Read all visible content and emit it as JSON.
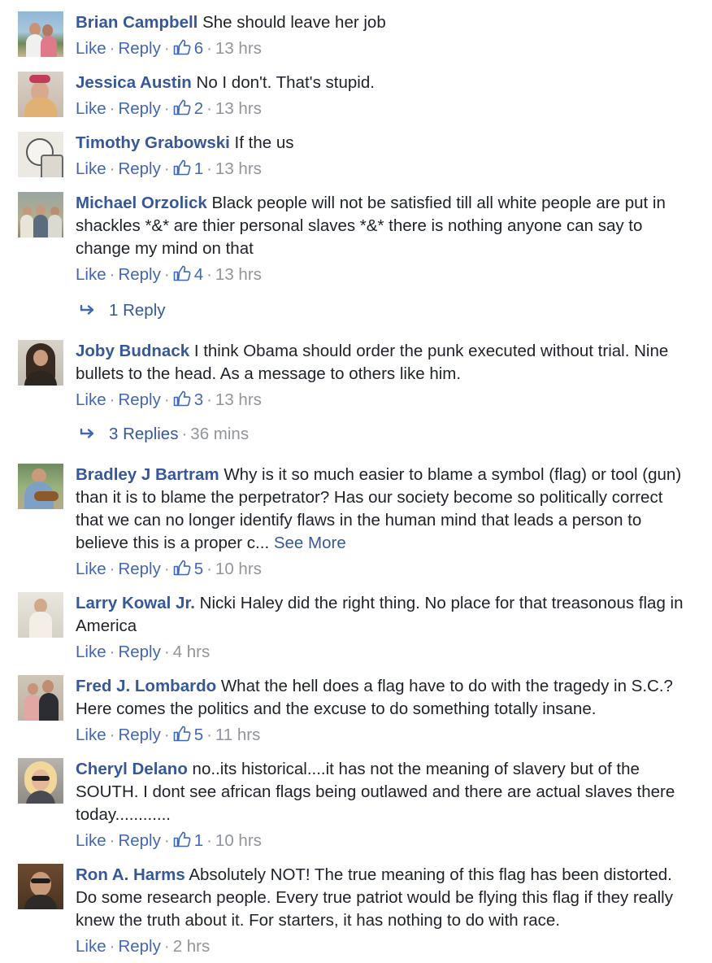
{
  "actions": {
    "like_label": "Like",
    "reply_label": "Reply",
    "separator": "·"
  },
  "comments": [
    {
      "author": "Brian Campbell",
      "text": " She should leave her job",
      "likes": "6",
      "time": "13 hrs"
    },
    {
      "author": "Jessica Austin",
      "text": " No I don't. That's stupid.",
      "likes": "2",
      "time": "13 hrs"
    },
    {
      "author": "Timothy Grabowski",
      "text": " If the us",
      "likes": "1",
      "time": "13 hrs"
    },
    {
      "author": "Michael Orzolick",
      "text": " Black people will not be satisfied till all white people are put in shackles *&* are thier personal slaves *&* there is nothing anyone can say to change my mind on that",
      "likes": "4",
      "time": "13 hrs",
      "replies_label": "1 Reply",
      "replies_time": ""
    },
    {
      "author": "Joby Budnack",
      "text": " I think Obama should order the punk executed without trial. Nine bullets to the head. As a message to others like him.",
      "likes": "3",
      "time": "13 hrs",
      "replies_label": "3 Replies",
      "replies_time": "36 mins"
    },
    {
      "author": "Bradley J Bartram",
      "text": " Why is it so much easier to blame a symbol (flag) or tool (gun) than it is to blame the perpetrator? Has our society become so politically correct that we can no longer identify flaws in the human mind that leads a person to believe this is a proper c... ",
      "see_more": "See More",
      "likes": "5",
      "time": "10 hrs"
    },
    {
      "author": "Larry Kowal Jr.",
      "text": " Nicki Haley did the right thing. No place for that treasonous flag in America",
      "likes": "",
      "time": "4 hrs"
    },
    {
      "author": "Fred J. Lombardo",
      "text": " What the hell does a flag have to do with the tragedy in S.C.? Here comes the politics and the excuse to do something totally insane.",
      "likes": "5",
      "time": "11 hrs"
    },
    {
      "author": "Cheryl Delano",
      "text": " no..its historical....it has not the meaning of slavery but of the SOUTH. I dont see african flags being outlawed and there are actual slaves there today............",
      "likes": "1",
      "time": "10 hrs"
    },
    {
      "author": "Ron A. Harms",
      "text": " Absolutely NOT! The true meaning of this flag has been distorted. Do some research people. Every true patriot would be flying this flag if they really knew the truth about it. For starters, it has nothing to do with race.",
      "likes": "",
      "time": "2 hrs"
    }
  ],
  "colors": {
    "author": "#365899",
    "action_link": "#4267b2",
    "meta": "#90949c",
    "text": "#1d2129"
  },
  "icons": {
    "like": "thumbs-up-icon",
    "reply_arrow": "reply-arrow-icon"
  }
}
